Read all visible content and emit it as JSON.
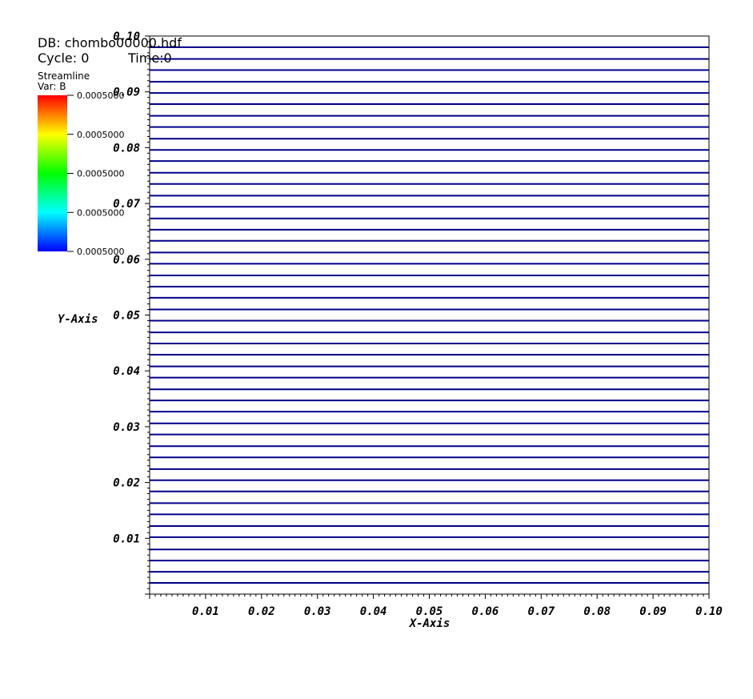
{
  "header": {
    "db_label": "DB: chombo00000.hdf",
    "cycle_label": "Cycle: 0",
    "time_label": "Time:0"
  },
  "legend": {
    "plot_type": "Streamline",
    "var_label": "Var: B",
    "tick_labels": [
      "0.0005000",
      "0.0005000",
      "0.0005000",
      "0.0005000",
      "0.0005000"
    ],
    "colors": [
      "#ff0000",
      "#ffff00",
      "#00ff00",
      "#00ffff",
      "#0000ff"
    ]
  },
  "chart_data": {
    "type": "line",
    "title": "",
    "xlabel": "X-Axis",
    "ylabel": "Y-Axis",
    "xlim": [
      0,
      0.1
    ],
    "ylim": [
      0,
      0.1
    ],
    "xticks": [
      "0.01",
      "0.02",
      "0.03",
      "0.04",
      "0.05",
      "0.06",
      "0.07",
      "0.08",
      "0.09",
      "0.10"
    ],
    "yticks": [
      "0.01",
      "0.02",
      "0.03",
      "0.04",
      "0.05",
      "0.06",
      "0.07",
      "0.08",
      "0.09",
      "0.10"
    ],
    "series_color": "#00008b",
    "streamline_y": [
      0.002,
      0.004,
      0.006,
      0.008,
      0.0102,
      0.0122,
      0.0143,
      0.0163,
      0.0184,
      0.0204,
      0.0224,
      0.0245,
      0.0265,
      0.0286,
      0.0306,
      0.0327,
      0.0347,
      0.0367,
      0.0388,
      0.0408,
      0.0429,
      0.0449,
      0.0469,
      0.049,
      0.051,
      0.0531,
      0.0551,
      0.0571,
      0.0592,
      0.0612,
      0.0633,
      0.0653,
      0.0673,
      0.0694,
      0.0714,
      0.0735,
      0.0755,
      0.0776,
      0.0796,
      0.0816,
      0.0837,
      0.0857,
      0.0878,
      0.0898,
      0.0918,
      0.0939,
      0.0959,
      0.098
    ]
  }
}
